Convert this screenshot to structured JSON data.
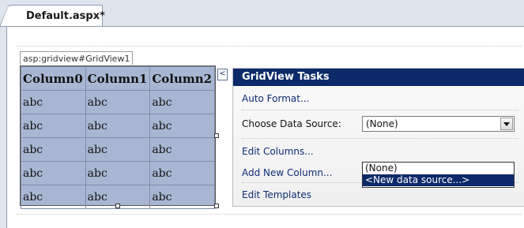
{
  "tab": {
    "title": "Default.aspx*"
  },
  "gridview": {
    "label": "asp:gridview#GridView1",
    "columns": [
      "Column0",
      "Column1",
      "Column2"
    ],
    "rows": [
      [
        "abc",
        "abc",
        "abc"
      ],
      [
        "abc",
        "abc",
        "abc"
      ],
      [
        "abc",
        "abc",
        "abc"
      ],
      [
        "abc",
        "abc",
        "abc"
      ],
      [
        "abc",
        "abc",
        "abc"
      ]
    ]
  },
  "smart_tag": {
    "glyph": "<"
  },
  "tasks": {
    "title": "GridView Tasks",
    "auto_format": "Auto Format...",
    "choose_data_source_label": "Choose Data Source:",
    "data_source_value": "(None)",
    "data_source_options": [
      "(None)",
      "<New data source...>"
    ],
    "edit_columns": "Edit Columns...",
    "add_new_column": "Add New Column...",
    "edit_templates": "Edit Templates"
  },
  "colors": {
    "grid_bg": "#a9b6d3",
    "tasks_header": "#0c2a6a",
    "link_text": "#0f2d75"
  }
}
